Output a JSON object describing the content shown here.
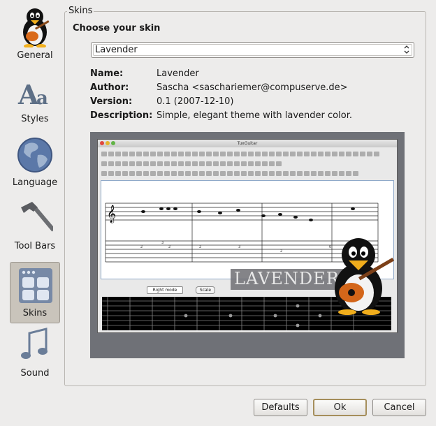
{
  "sidebar": {
    "items": [
      {
        "label": "General",
        "icon": "tux-guitar-icon"
      },
      {
        "label": "Styles",
        "icon": "font-aa-icon"
      },
      {
        "label": "Language",
        "icon": "globe-icon"
      },
      {
        "label": "Tool Bars",
        "icon": "hammer-icon"
      },
      {
        "label": "Skins",
        "icon": "skins-grid-icon",
        "selected": true
      },
      {
        "label": "Sound",
        "icon": "music-note-icon"
      }
    ]
  },
  "skins": {
    "group_title": "Skins",
    "heading": "Choose your skin",
    "selected_skin": "Lavender",
    "fields": {
      "name_label": "Name:",
      "name_value": "Lavender",
      "author_label": "Author:",
      "author_value": "Sascha <saschariemer@compuserve.de>",
      "version_label": "Version:",
      "version_value": "0.1 (2007-12-10)",
      "description_label": "Description:",
      "description_value": "Simple, elegant theme with lavender color."
    },
    "preview": {
      "window_title": "TuxGuitar",
      "banner": "LAVENDER",
      "mode_select": "Right mode",
      "scale_button": "Scale"
    }
  },
  "buttons": {
    "defaults": "Defaults",
    "ok": "Ok",
    "cancel": "Cancel"
  },
  "colors": {
    "selected_bg": "#c9c4bb",
    "window_bg": "#edeceb",
    "preview_bg": "#6f7177"
  }
}
